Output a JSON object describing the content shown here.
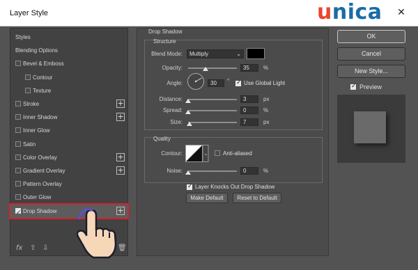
{
  "window": {
    "title": "Layer Style",
    "close_glyph": "✕"
  },
  "brand": {
    "logo_first": "u",
    "logo_rest": "nica"
  },
  "styles_panel": {
    "items": [
      {
        "label": "Styles",
        "checkbox": false,
        "checked": false,
        "plus": false,
        "indent": 0
      },
      {
        "label": "Blending Options",
        "checkbox": false,
        "checked": false,
        "plus": false,
        "indent": 0
      },
      {
        "label": "Bevel & Emboss",
        "checkbox": true,
        "checked": false,
        "plus": false,
        "indent": 0
      },
      {
        "label": "Contour",
        "checkbox": true,
        "checked": false,
        "plus": false,
        "indent": 1
      },
      {
        "label": "Texture",
        "checkbox": true,
        "checked": false,
        "plus": false,
        "indent": 1
      },
      {
        "label": "Stroke",
        "checkbox": true,
        "checked": false,
        "plus": true,
        "indent": 0
      },
      {
        "label": "Inner Shadow",
        "checkbox": true,
        "checked": false,
        "plus": true,
        "indent": 0
      },
      {
        "label": "Inner Glow",
        "checkbox": true,
        "checked": false,
        "plus": false,
        "indent": 0
      },
      {
        "label": "Satin",
        "checkbox": true,
        "checked": false,
        "plus": false,
        "indent": 0
      },
      {
        "label": "Color Overlay",
        "checkbox": true,
        "checked": false,
        "plus": true,
        "indent": 0
      },
      {
        "label": "Gradient Overlay",
        "checkbox": true,
        "checked": false,
        "plus": true,
        "indent": 0
      },
      {
        "label": "Pattern Overlay",
        "checkbox": true,
        "checked": false,
        "plus": false,
        "indent": 0
      },
      {
        "label": "Outer Glow",
        "checkbox": true,
        "checked": false,
        "plus": false,
        "indent": 0
      },
      {
        "label": "Drop Shadow",
        "checkbox": true,
        "checked": true,
        "plus": true,
        "indent": 0,
        "selected": true
      }
    ],
    "fx_label": "fx",
    "highlight_color": "#d8222a"
  },
  "drop_shadow": {
    "section_title": "Drop Shadow",
    "structure": {
      "title": "Structure",
      "blend_mode_label": "Blend Mode:",
      "blend_mode_value": "Multiply",
      "shadow_color": "#000000",
      "opacity_label": "Opacity:",
      "opacity_value": "35",
      "angle_label": "Angle:",
      "angle_value": "30",
      "angle_unit": "°",
      "use_global_light_label": "Use Global Light",
      "use_global_light_checked": true,
      "distance_label": "Distance:",
      "distance_value": "3",
      "spread_label": "Spread:",
      "spread_value": "0",
      "size_label": "Size:",
      "size_value": "7",
      "unit_percent": "%",
      "unit_px": "px",
      "opacity_level": 0.35,
      "distance_level": 0.0,
      "spread_level": 0.0,
      "size_level": 0.03
    },
    "quality": {
      "title": "Quality",
      "contour_label": "Contour:",
      "anti_aliased_label": "Anti-aliased",
      "anti_aliased_checked": false,
      "noise_label": "Noise:",
      "noise_value": "0",
      "noise_level": 0.0
    },
    "knocks_out_label": "Layer Knocks Out Drop Shadow",
    "knocks_out_checked": true,
    "make_default_label": "Make Default",
    "reset_default_label": "Reset to Default"
  },
  "actions": {
    "ok_label": "OK",
    "cancel_label": "Cancel",
    "new_style_label": "New Style...",
    "preview_label": "Preview",
    "preview_checked": true
  }
}
